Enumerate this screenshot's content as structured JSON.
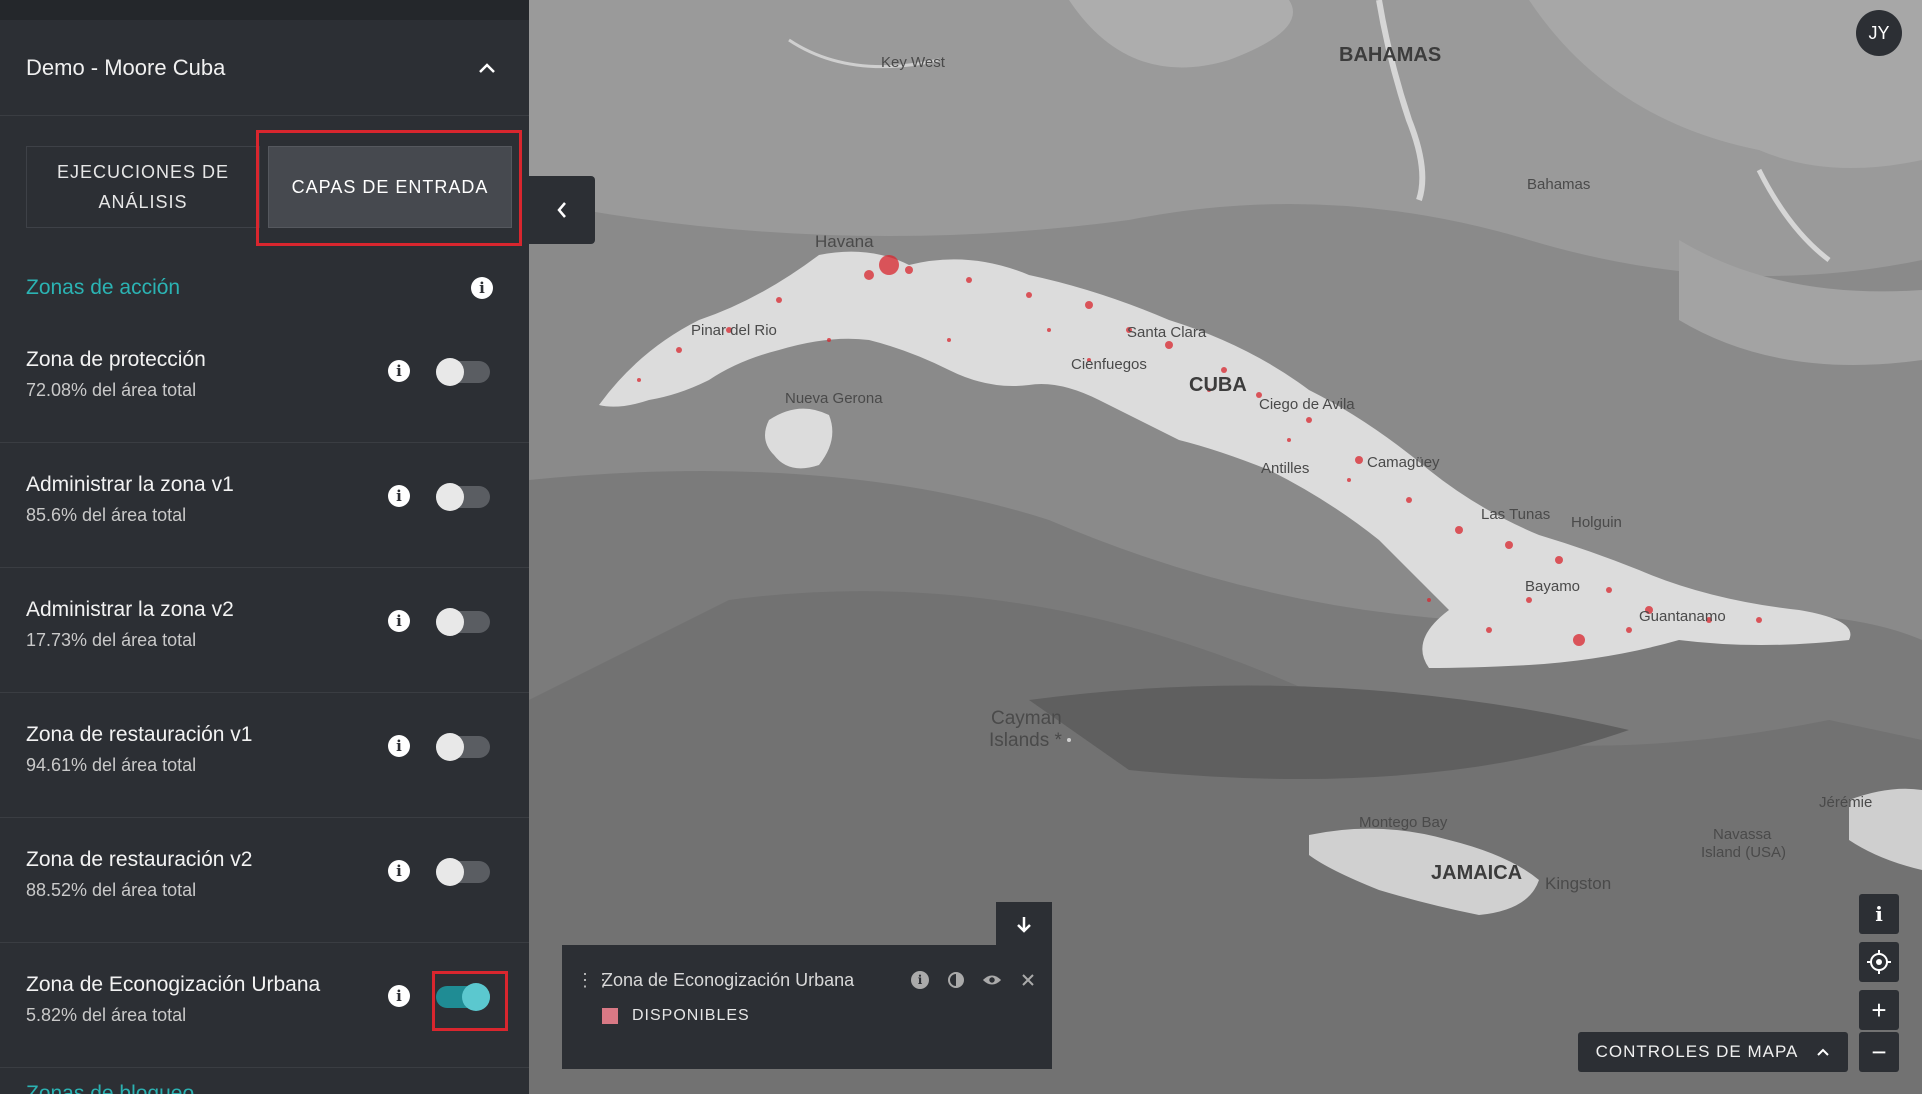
{
  "sidebar": {
    "project_title": "Demo - Moore Cuba",
    "tabs": [
      {
        "label": "EJECUCIONES DE ANÁLISIS"
      },
      {
        "label": "CAPAS DE ENTRADA"
      }
    ],
    "section_title": "Zonas de acción",
    "layers": [
      {
        "name": "Zona de protección",
        "pct": "72.08% del área total",
        "enabled": false
      },
      {
        "name": "Administrar la zona v1",
        "pct": "85.6% del área total",
        "enabled": false
      },
      {
        "name": "Administrar la zona v2",
        "pct": "17.73% del área total",
        "enabled": false
      },
      {
        "name": "Zona de restauración v1",
        "pct": "94.61% del área total",
        "enabled": false
      },
      {
        "name": "Zona de restauración v2",
        "pct": "88.52% del área total",
        "enabled": false
      },
      {
        "name": "Zona de Econogización Urbana",
        "pct": "5.82% del área total",
        "enabled": true
      }
    ],
    "next_section_partial": "Zonas de bloqueo"
  },
  "user": {
    "initials": "JY"
  },
  "map": {
    "labels": {
      "bahamas_region": "BAHAMAS",
      "key_west": "Key West",
      "bahamas": "Bahamas",
      "havana": "Havana",
      "pinar": "Pinar del Rio",
      "santa_clara": "Santa Clara",
      "cienfuegos": "Cienfuegos",
      "cuba": "CUBA",
      "nueva_gerona": "Nueva Gerona",
      "ciego": "Ciego de Avila",
      "antilles": "Antilles",
      "camaguey": "Camagüey",
      "las_tunas": "Las Tunas",
      "holguin": "Holguin",
      "bayamo": "Bayamo",
      "guantanamo": "Guantanamo",
      "cayman": "Cayman",
      "cayman2": "Islands *",
      "montego": "Montego Bay",
      "jamaica": "JAMAICA",
      "kingston": "Kingston",
      "navassa": "Navassa",
      "navassa2": "Island (USA)",
      "jeremie": "Jérémie"
    },
    "highlight_color": "#d9262e"
  },
  "legend": {
    "title": "Zona de Econogización Urbana",
    "item_label": "DISPONIBLES",
    "item_color": "#d97985"
  },
  "controls": {
    "info": "i",
    "zoom_in": "+",
    "zoom_out": "−",
    "map_controls_label": "CONTROLES DE MAPA"
  }
}
